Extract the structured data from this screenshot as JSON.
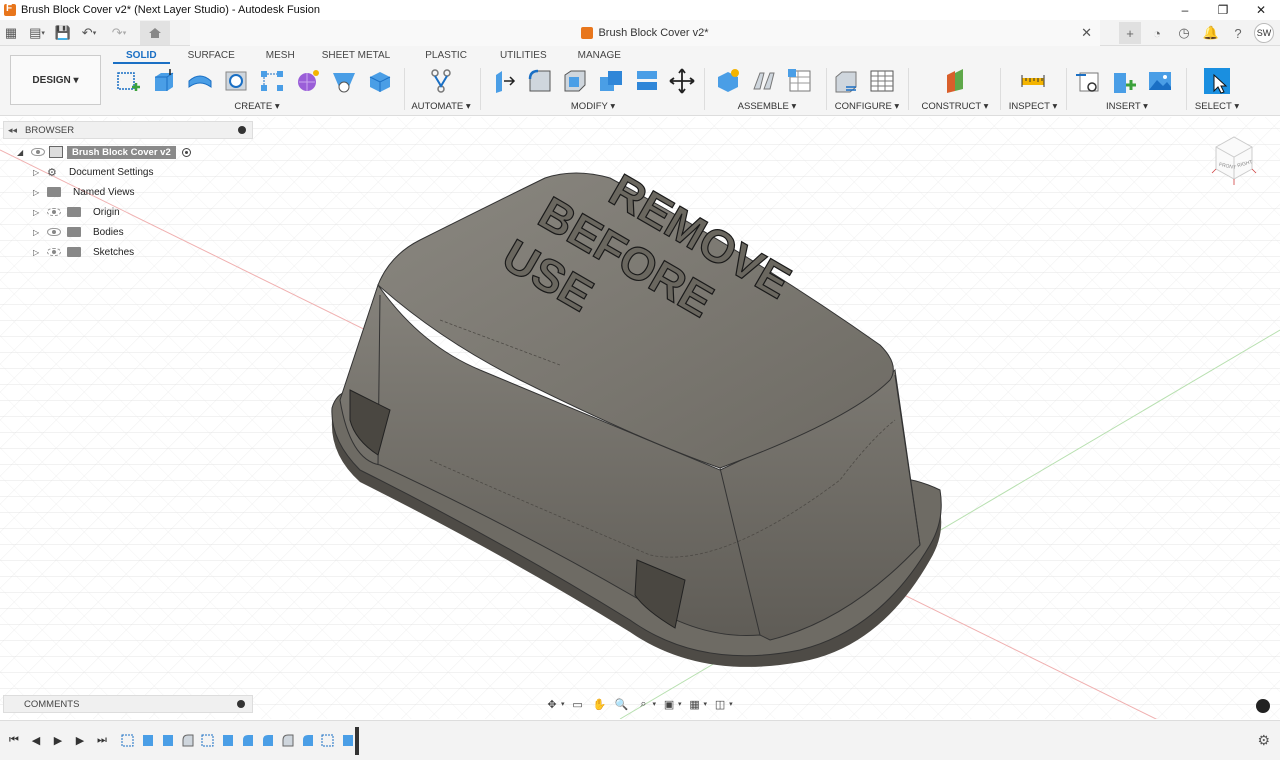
{
  "window": {
    "title": "Brush Block Cover v2* (Next Layer Studio) - Autodesk Fusion",
    "controls": [
      "–",
      "❐",
      "✕"
    ]
  },
  "tabbar": {
    "doc_title": "Brush Block Cover v2*",
    "close": "✕",
    "avatar": "SW"
  },
  "ribbon": {
    "workspace": "DESIGN",
    "tabs": [
      "SOLID",
      "SURFACE",
      "MESH",
      "SHEET METAL",
      "PLASTIC",
      "UTILITIES",
      "MANAGE"
    ],
    "active_tab": "SOLID",
    "groups": {
      "create": "CREATE",
      "automate": "AUTOMATE",
      "modify": "MODIFY",
      "assemble": "ASSEMBLE",
      "configure": "CONFIGURE",
      "construct": "CONSTRUCT",
      "inspect": "INSPECT",
      "insert": "INSERT",
      "select": "SELECT"
    },
    "caret": "▾"
  },
  "browser": {
    "title": "BROWSER",
    "root": "Brush Block Cover v2",
    "items": [
      "Document Settings",
      "Named Views",
      "Origin",
      "Bodies",
      "Sketches"
    ]
  },
  "model": {
    "text_lines": [
      "REMOVE",
      "BEFORE",
      "USE"
    ]
  },
  "viewcube": {
    "front": "FRONT",
    "right": "RIGHT"
  },
  "comments": {
    "title": "COMMENTS"
  },
  "colors": {
    "accent": "#1a6fc4",
    "body": "#77736c",
    "brand": "#e8761c"
  }
}
